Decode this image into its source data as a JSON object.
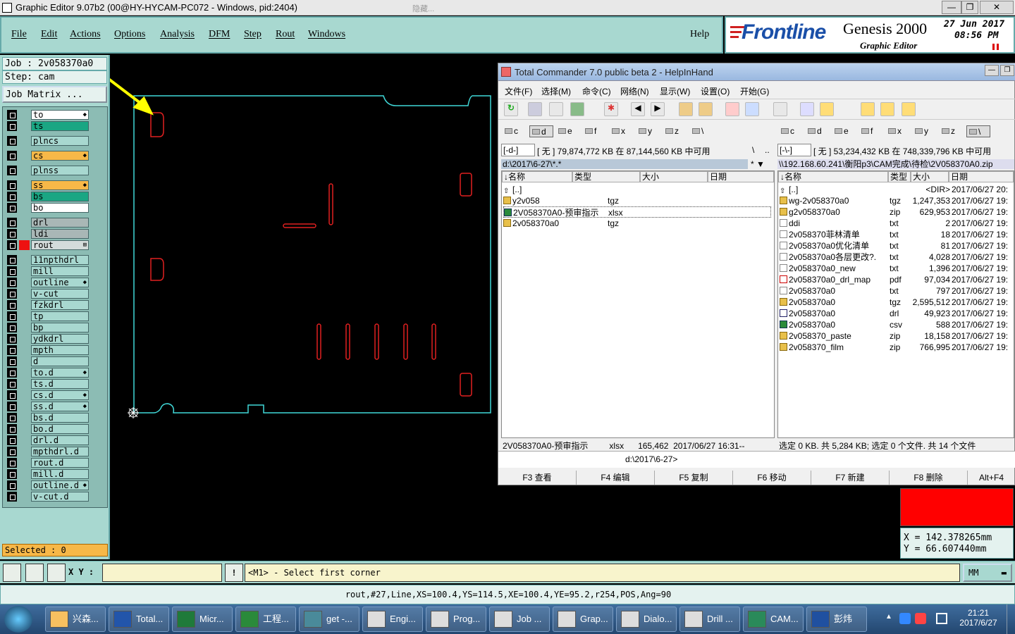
{
  "window": {
    "title": "Graphic Editor 9.07b2 (00@HY-HYCAM-PC072 - Windows, pid:2404)",
    "hidden_text": "隐藏..."
  },
  "menubar": {
    "items": [
      "File",
      "Edit",
      "Actions",
      "Options",
      "Analysis",
      "DFM",
      "Step",
      "Rout",
      "Windows"
    ],
    "help": "Help"
  },
  "banner": {
    "brand": "Frontline",
    "product": "Genesis 2000",
    "date": "27 Jun 2017",
    "time": "08:56 PM",
    "subtitle": "Graphic Editor"
  },
  "job": {
    "job_line": "Job  : 2v058370a0",
    "step_line": "Step: cam",
    "matrix_button": "Job Matrix ..."
  },
  "layers": [
    {
      "name": "to",
      "color": "#ffffff",
      "mark": "◆"
    },
    {
      "name": "ts",
      "color": "#1aa683",
      "mark": ""
    },
    {
      "name": "plncs",
      "color": "#a8d8d0",
      "mark": ""
    },
    {
      "name": "cs",
      "color": "#f7b848",
      "mark": "◆"
    },
    {
      "name": "plnss",
      "color": "#a8d8d0",
      "mark": ""
    },
    {
      "name": "ss",
      "color": "#f7b848",
      "mark": "◆"
    },
    {
      "name": "bs",
      "color": "#1aa683",
      "mark": ""
    },
    {
      "name": "bo",
      "color": "#ffffff",
      "mark": ""
    },
    {
      "name": "drl",
      "color": "#a9b7b6",
      "mark": ""
    },
    {
      "name": "ldi",
      "color": "#a9b7b6",
      "mark": ""
    },
    {
      "name": "rout",
      "color": "#d4dcdb",
      "mark": "⊞"
    },
    {
      "name": "11npthdrl",
      "color": "#a8d8d0",
      "mark": ""
    },
    {
      "name": "mill",
      "color": "#a8d8d0",
      "mark": ""
    },
    {
      "name": "outline",
      "color": "#a8d8d0",
      "mark": "◆"
    },
    {
      "name": "v-cut",
      "color": "#a8d8d0",
      "mark": ""
    },
    {
      "name": "fzkdrl",
      "color": "#a8d8d0",
      "mark": ""
    },
    {
      "name": "tp",
      "color": "#a8d8d0",
      "mark": ""
    },
    {
      "name": "bp",
      "color": "#a8d8d0",
      "mark": ""
    },
    {
      "name": "ydkdrl",
      "color": "#a8d8d0",
      "mark": ""
    },
    {
      "name": "mpth",
      "color": "#a8d8d0",
      "mark": ""
    },
    {
      "name": "d",
      "color": "#a8d8d0",
      "mark": ""
    },
    {
      "name": "to.d",
      "color": "#a8d8d0",
      "mark": "◆"
    },
    {
      "name": "ts.d",
      "color": "#a8d8d0",
      "mark": ""
    },
    {
      "name": "cs.d",
      "color": "#a8d8d0",
      "mark": "◆"
    },
    {
      "name": "ss.d",
      "color": "#a8d8d0",
      "mark": "◆"
    },
    {
      "name": "bs.d",
      "color": "#a8d8d0",
      "mark": ""
    },
    {
      "name": "bo.d",
      "color": "#a8d8d0",
      "mark": ""
    },
    {
      "name": "drl.d",
      "color": "#a8d8d0",
      "mark": ""
    },
    {
      "name": "mpthdrl.d",
      "color": "#a8d8d0",
      "mark": ""
    },
    {
      "name": "rout.d",
      "color": "#a8d8d0",
      "mark": ""
    },
    {
      "name": "mill.d",
      "color": "#a8d8d0",
      "mark": ""
    },
    {
      "name": "outline.d",
      "color": "#a8d8d0",
      "mark": "◆"
    },
    {
      "name": "v-cut.d",
      "color": "#a8d8d0",
      "mark": ""
    }
  ],
  "selected": "Selected : 0",
  "command": {
    "xy_label": "X Y :",
    "xy_value": "",
    "prompt": "<M1> - Select first corner",
    "units": "MM",
    "status": "rout,#27,Line,XS=100.4,YS=114.5,XE=100.4,YE=95.2,r254,POS,Ang=90"
  },
  "coords": {
    "x": "X  =  142.378265mm",
    "y": "Y  =  66.607440mm"
  },
  "tc": {
    "title": "Total Commander 7.0 public beta 2 - HelpInHand",
    "menu": [
      "文件(F)",
      "选择(M)",
      "命令(C)",
      "网络(N)",
      "显示(W)",
      "设置(O)",
      "开始(G)"
    ],
    "left_drives": [
      "c",
      "d",
      "e",
      "f",
      "x",
      "y",
      "z",
      "\\"
    ],
    "right_drives": [
      "c",
      "d",
      "e",
      "f",
      "x",
      "y",
      "z",
      "\\"
    ],
    "left_drive_sel": "[-d-]",
    "left_free": "[ 无 ]  79,874,772 KB 在 87,144,560 KB 中可用",
    "left_root": "\\",
    "left_up": "..",
    "left_path": "d:\\2017\\6-27\\*.*",
    "right_drive_sel": "[-\\-]",
    "right_free": "[ 无 ]  53,234,432 KB 在 748,339,796 KB 中可用",
    "right_path": "\\\\192.168.60.241\\衡阳p3\\CAM完成\\待检\\2V058370A0.zip",
    "headers": {
      "name": "↓名称",
      "type": "类型",
      "size": "大小",
      "date": "日期"
    },
    "left_files": [
      {
        "name": "[..]",
        "type": "",
        "icon": "up"
      },
      {
        "name": "y2v058",
        "type": "tgz",
        "icon": "arc"
      },
      {
        "name": "2V058370A0-预审指示",
        "type": "xlsx",
        "icon": "xls"
      },
      {
        "name": "2v058370a0",
        "type": "tgz",
        "icon": "arc"
      }
    ],
    "right_files": [
      {
        "name": "[..]",
        "type": "",
        "size": "<DIR>",
        "date": "2017/06/27 20:",
        "icon": "up"
      },
      {
        "name": "wg-2v058370a0",
        "type": "tgz",
        "size": "1,247,353",
        "date": "2017/06/27 19:",
        "icon": "arc"
      },
      {
        "name": "g2v058370a0",
        "type": "zip",
        "size": "629,953",
        "date": "2017/06/27 19:",
        "icon": "arc"
      },
      {
        "name": "ddi",
        "type": "txt",
        "size": "2",
        "date": "2017/06/27 19:",
        "icon": "txt"
      },
      {
        "name": "2v058370菲林清单",
        "type": "txt",
        "size": "18",
        "date": "2017/06/27 19:",
        "icon": "txt"
      },
      {
        "name": "2v058370a0优化清单",
        "type": "txt",
        "size": "81",
        "date": "2017/06/27 19:",
        "icon": "txt"
      },
      {
        "name": "2v058370a0各层更改?.",
        "type": "txt",
        "size": "4,028",
        "date": "2017/06/27 19:",
        "icon": "txt"
      },
      {
        "name": "2v058370a0_new",
        "type": "txt",
        "size": "1,396",
        "date": "2017/06/27 19:",
        "icon": "txt"
      },
      {
        "name": "2v058370a0_drl_map",
        "type": "pdf",
        "size": "97,034",
        "date": "2017/06/27 19:",
        "icon": "pdf"
      },
      {
        "name": "2v058370a0",
        "type": "txt",
        "size": "797",
        "date": "2017/06/27 19:",
        "icon": "txt"
      },
      {
        "name": "2v058370a0",
        "type": "tgz",
        "size": "2,595,512",
        "date": "2017/06/27 19:",
        "icon": "arc"
      },
      {
        "name": "2v058370a0",
        "type": "drl",
        "size": "49,923",
        "date": "2017/06/27 19:",
        "icon": "drl"
      },
      {
        "name": "2v058370a0",
        "type": "csv",
        "size": "588",
        "date": "2017/06/27 19:",
        "icon": "csv"
      },
      {
        "name": "2v058370_paste",
        "type": "zip",
        "size": "18,158",
        "date": "2017/06/27 19:",
        "icon": "arc"
      },
      {
        "name": "2v058370_film",
        "type": "zip",
        "size": "766,995",
        "date": "2017/06/27 19:",
        "icon": "arc"
      }
    ],
    "left_status": "2V058370A0-预审指示         xlsx      165,462  2017/06/27 16:31--",
    "right_status": "选定 0 KB. 共 5,284 KB; 选定 0 个文件. 共 14 个文件",
    "cmdline": "d:\\2017\\6-27>",
    "fkeys": [
      "F3 查看",
      "F4 编辑",
      "F5 复制",
      "F6 移动",
      "F7 新建",
      "F8 删除",
      "Alt+F4"
    ]
  },
  "taskbar": {
    "items": [
      "兴森...",
      "Total...",
      "Micr...",
      "工程...",
      "get -...",
      "Engi...",
      "Prog...",
      "Job ...",
      "Grap...",
      "Dialo...",
      "Drill ...",
      "CAM...",
      "彭炜"
    ],
    "time": "21:21",
    "date": "2017/6/27"
  }
}
